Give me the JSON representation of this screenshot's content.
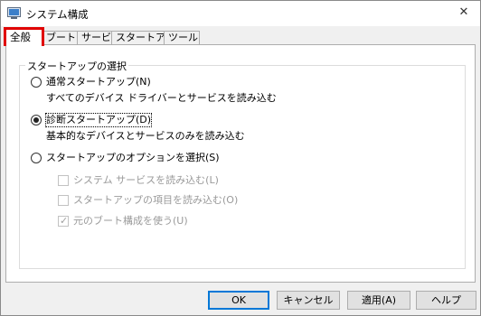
{
  "window": {
    "title": "システム構成"
  },
  "tabs": [
    {
      "label": "全般"
    },
    {
      "label": "ブート"
    },
    {
      "label": "サービス"
    },
    {
      "label": "スタートアップ"
    },
    {
      "label": "ツール"
    }
  ],
  "group": {
    "title": "スタートアップの選択",
    "options": [
      {
        "label": "通常スタートアップ(N)",
        "description": "すべてのデバイス ドライバーとサービスを読み込む",
        "selected": false
      },
      {
        "label": "診断スタートアップ(D)",
        "description": "基本的なデバイスとサービスのみを読み込む",
        "selected": true
      },
      {
        "label": "スタートアップのオプションを選択(S)",
        "selected": false
      }
    ],
    "checkboxes": [
      {
        "label": "システム サービスを読み込む(L)",
        "checked": false
      },
      {
        "label": "スタートアップの項目を読み込む(O)",
        "checked": false
      },
      {
        "label": "元のブート構成を使う(U)",
        "checked": true
      }
    ]
  },
  "buttons": {
    "ok": "OK",
    "cancel": "キャンセル",
    "apply": "適用(A)",
    "help": "ヘルプ"
  },
  "icons": {
    "app": "msconfig-icon",
    "close": "close-icon"
  },
  "colors": {
    "highlight": "#e00000",
    "accent": "#0078d7"
  }
}
